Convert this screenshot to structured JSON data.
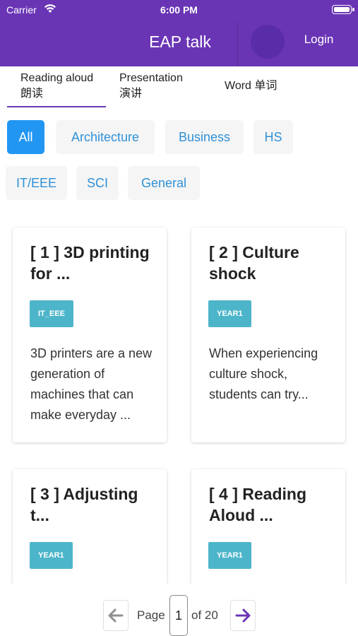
{
  "status": {
    "carrier": "Carrier",
    "time": "6:00 PM"
  },
  "appbar": {
    "title": "EAP talk",
    "login_label": "Login",
    "color": "#6a35b5"
  },
  "tabs": [
    {
      "label": "Reading aloud 朗读",
      "selected": true
    },
    {
      "label": "Presentation 演讲",
      "selected": false
    },
    {
      "label": "Word 单词",
      "selected": false
    }
  ],
  "filters": {
    "items": [
      "All",
      "Architecture",
      "Business",
      "HS",
      "IT/EEE",
      "SCI",
      "General"
    ],
    "selected": "All",
    "active_color": "#2196f3"
  },
  "cards": [
    {
      "title": "[ 1 ] 3D printing for ...",
      "badge": "IT_EEE",
      "excerpt": "3D printers are a new generation of machines that can make everyday ..."
    },
    {
      "title": "[ 2 ] Culture shock",
      "badge": "YEAR1",
      "excerpt": "When experiencing culture shock, students can try..."
    },
    {
      "title": "[ 3 ] Adjusting t...",
      "badge": "YEAR1",
      "excerpt": ""
    },
    {
      "title": "[ 4 ] Reading Aloud ...",
      "badge": "YEAR1",
      "excerpt": ""
    }
  ],
  "pagination": {
    "page_label": "Page",
    "current_page": "1",
    "total_label": "of 20",
    "prev_icon": "arrow-left-icon",
    "next_icon": "arrow-right-icon"
  }
}
